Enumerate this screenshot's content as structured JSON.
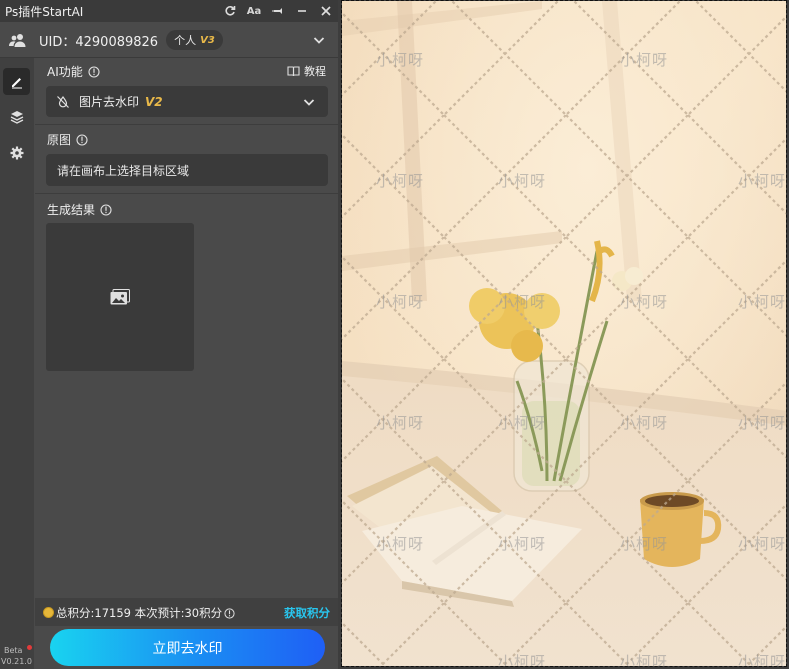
{
  "panel": {
    "title": "Ps插件StartAI",
    "uid_label": "UID：4290089826",
    "plan_label": "个人",
    "plan_version": "V3",
    "ai_function_label": "AI功能",
    "tutorial_label": "教程",
    "function_select": {
      "label": "图片去水印",
      "version": "V2"
    },
    "original_label": "原图",
    "original_placeholder": "请在画布上选择目标区域",
    "result_label": "生成结果",
    "points_text": "总积分:17159  本次预计:30积分",
    "get_points_label": "获取积分",
    "action_button_label": "立即去水印",
    "beta_label": "Beta",
    "version_label": "V0.21.0"
  },
  "canvas": {
    "watermark_text": "小柯呀"
  },
  "colors": {
    "accent_gradient_start": "#19d3f0",
    "accent_gradient_end": "#1f5ff5",
    "version_gold": "#e9b949",
    "link_blue": "#28c7f0"
  }
}
